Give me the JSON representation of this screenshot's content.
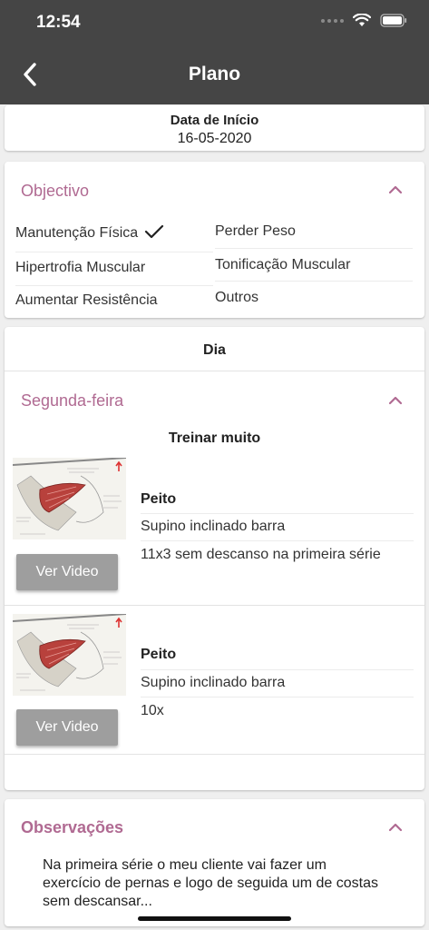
{
  "status_bar": {
    "time": "12:54"
  },
  "header": {
    "title": "Plano"
  },
  "start_date": {
    "label": "Data de Início",
    "value": "16-05-2020"
  },
  "objective": {
    "title": "Objectivo",
    "options": [
      {
        "label": "Manutenção Física",
        "checked": true
      },
      {
        "label": "Perder Peso",
        "checked": false
      },
      {
        "label": "Hipertrofia Muscular",
        "checked": false
      },
      {
        "label": "Tonificação Muscular",
        "checked": false
      },
      {
        "label": "Aumentar Resistência",
        "checked": false
      },
      {
        "label": "Outros",
        "checked": false
      }
    ]
  },
  "plan": {
    "day_header": "Dia",
    "day_name": "Segunda-feira",
    "subtitle": "Treinar muito",
    "exercises": [
      {
        "muscle": "Peito",
        "name": "Supino inclinado barra",
        "reps": "11x3 sem descanso na primeira série",
        "button": "Ver Video"
      },
      {
        "muscle": "Peito",
        "name": "Supino inclinado barra",
        "reps": "10x",
        "button": "Ver Video"
      }
    ]
  },
  "observations": {
    "title": "Observações",
    "text": "Na primeira série o meu cliente vai fazer um exercício de pernas e logo de seguida um de costas sem descansar..."
  },
  "colors": {
    "accent": "#b06a92",
    "appbar": "#454545",
    "button": "#9e9e9e"
  }
}
